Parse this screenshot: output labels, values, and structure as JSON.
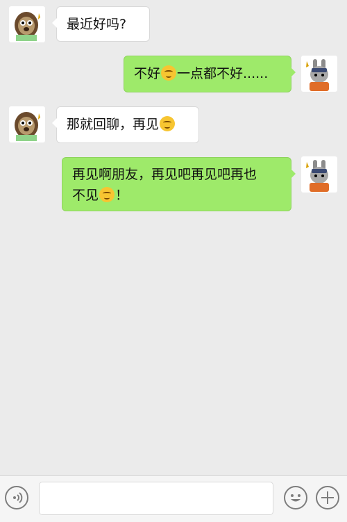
{
  "messages": [
    {
      "side": "left",
      "avatar": "sloth-avatar-icon",
      "text": "最近好吗?",
      "emoji": false
    },
    {
      "side": "right",
      "avatar": "rabbit-avatar-icon",
      "text_before": "不好",
      "text_after": "一点都不好......",
      "emoji": true
    },
    {
      "side": "left",
      "avatar": "sloth-avatar-icon",
      "text": "那就回聊，再见",
      "emoji": true
    },
    {
      "side": "right",
      "avatar": "rabbit-avatar-icon",
      "line1": "再见啊朋友，再见吧再见吧再也",
      "line2_before": "不见",
      "line2_after": "！",
      "emoji": true
    }
  ],
  "input_bar": {
    "voice_icon": "voice-icon",
    "emoji_icon": "emoji-smile-icon",
    "plus_icon": "plus-icon",
    "placeholder": ""
  },
  "colors": {
    "background": "#ebebeb",
    "sent_bubble": "#9eea6a",
    "received_bubble": "#ffffff"
  }
}
